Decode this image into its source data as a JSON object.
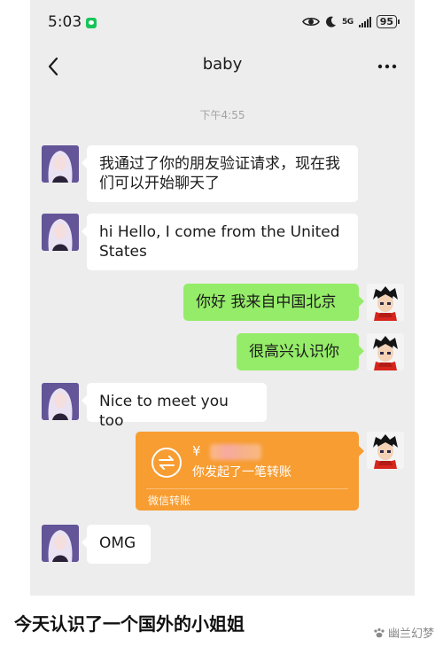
{
  "status_bar": {
    "time": "5:03",
    "signal_text": "5G",
    "battery": "95"
  },
  "header": {
    "title": "baby"
  },
  "timestamp": "下午4:55",
  "messages": [
    {
      "side": "left",
      "text": "我通过了你的朋友验证请求，现在我们可以开始聊天了"
    },
    {
      "side": "left",
      "text": "hi Hello, I come from the United States"
    },
    {
      "side": "right",
      "text": "你好 我来自中国北京"
    },
    {
      "side": "right",
      "text": "很高兴认识你"
    },
    {
      "side": "left",
      "text": "Nice to meet you too"
    },
    {
      "side": "left",
      "text": "OMG"
    }
  ],
  "transfer": {
    "amount": "¥",
    "description": "你发起了一笔转账",
    "footer": "微信转账"
  },
  "caption": "今天认识了一个国外的小姐姐",
  "watermark": "幽兰幻梦",
  "colors": {
    "chat_background": "#ededed",
    "incoming_bubble": "#ffffff",
    "outgoing_bubble": "#95ec69",
    "transfer_card": "#f79d32"
  }
}
